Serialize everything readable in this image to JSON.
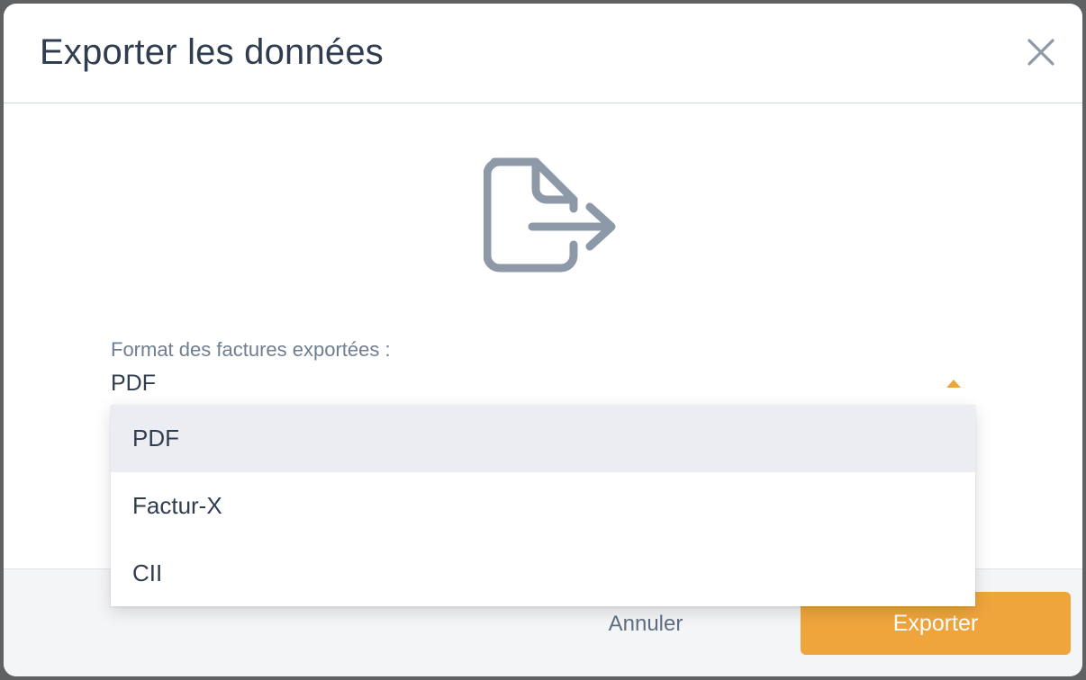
{
  "dialog": {
    "title": "Exporter les données",
    "close_icon": "close-icon",
    "illustration_icon": "file-export-icon"
  },
  "format_field": {
    "label": "Format des factures exportées :",
    "value": "PDF",
    "caret_icon": "caret-up-icon",
    "options": [
      "PDF",
      "Factur-X",
      "CII"
    ],
    "selected_index": 0
  },
  "footer": {
    "cancel_label": "Annuler",
    "export_label": "Exporter"
  },
  "colors": {
    "accent": "#f0a53c",
    "title_text": "#2f3d4f",
    "muted_text": "#6f7e91",
    "icon_gray": "#8e99a8",
    "selected_option_bg": "#ecedf3"
  }
}
